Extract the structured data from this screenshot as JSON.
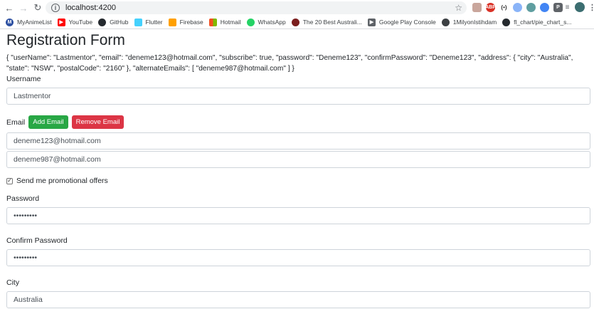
{
  "browser": {
    "url": "localhost:4200",
    "bookmarks": [
      {
        "label": "MyAnimeList",
        "color": "#2e51a2"
      },
      {
        "label": "YouTube",
        "color": "#ff0000"
      },
      {
        "label": "GitHub",
        "color": "#24292e"
      },
      {
        "label": "Flutter",
        "color": "#45d1fd"
      },
      {
        "label": "Firebase",
        "color": "#ffa000"
      },
      {
        "label": "Hotmail",
        "color": "#00a4ef"
      },
      {
        "label": "WhatsApp",
        "color": "#25d366"
      },
      {
        "label": "The 20 Best Australi...",
        "color": "#7b1e1e"
      },
      {
        "label": "Google Play Console",
        "color": "#5f6368"
      },
      {
        "label": "1MilyonIstihdam",
        "color": "#3c4043"
      },
      {
        "label": "fl_chart/pie_chart_s...",
        "color": "#24292e"
      }
    ]
  },
  "form": {
    "title": "Registration Form",
    "json_preview": "{ \"userName\": \"Lastmentor\", \"email\": \"deneme123@hotmail.com\", \"subscribe\": true, \"password\": \"Deneme123\", \"confirmPassword\": \"Deneme123\", \"address\": { \"city\": \"Australia\", \"state\": \"NSW\", \"postalCode\": \"2160\" }, \"alternateEmails\": [ \"deneme987@hotmail.com\" ] }",
    "username_label": "Username",
    "username_value": "Lastmentor",
    "email_label": "Email",
    "add_email_label": "Add Email",
    "remove_email_label": "Remove Email",
    "email_value": "deneme123@hotmail.com",
    "alternate_email_value": "deneme987@hotmail.com",
    "subscribe_label": "Send me promotional offers",
    "subscribe_checked": true,
    "password_label": "Password",
    "password_value": "•••••••••",
    "confirm_password_label": "Confirm Password",
    "confirm_password_value": "•••••••••",
    "city_label": "City",
    "city_value": "Australia"
  }
}
